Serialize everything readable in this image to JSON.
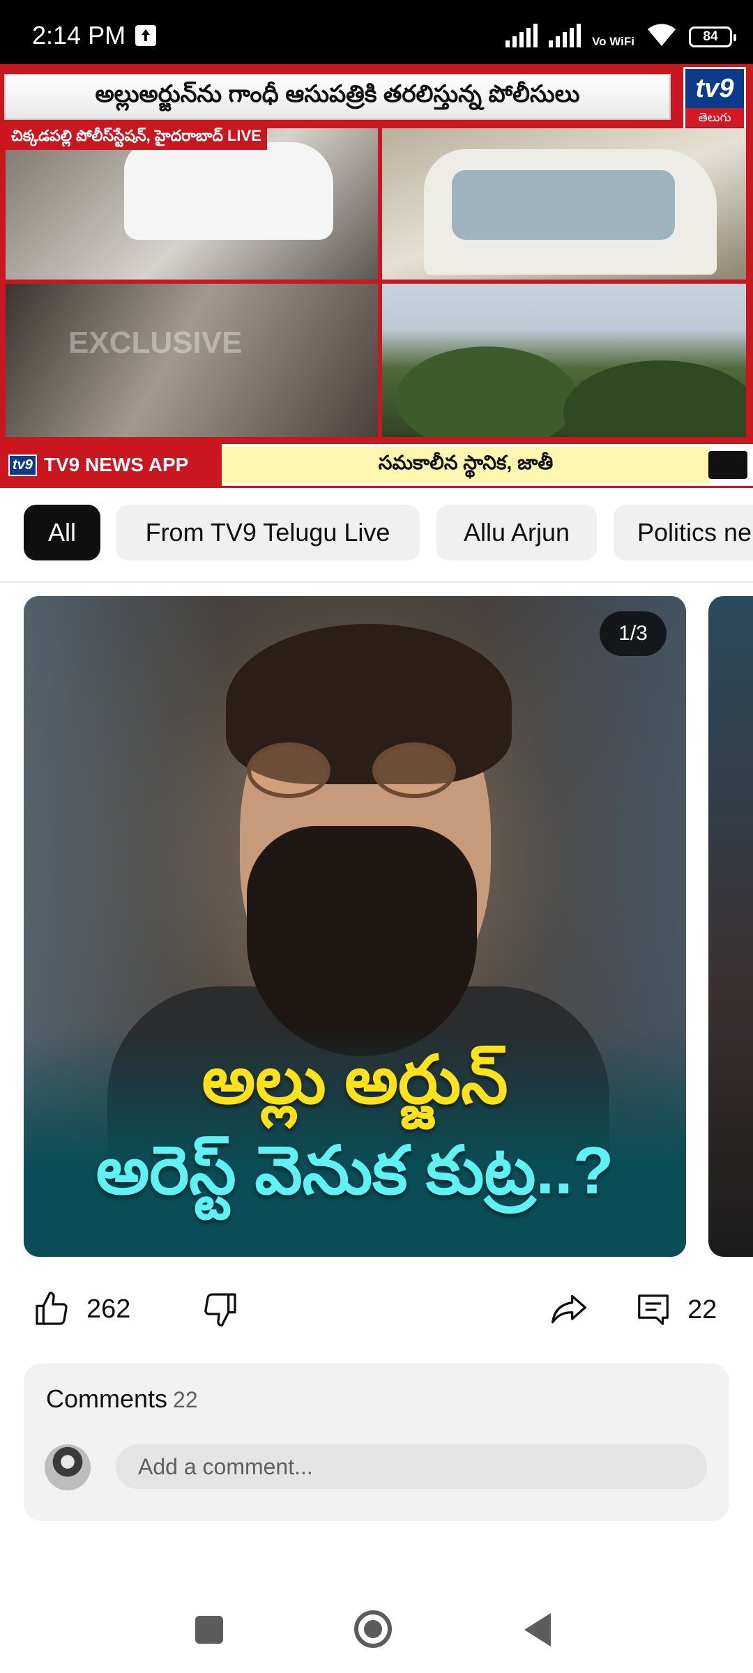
{
  "status_bar": {
    "time": "2:14 PM",
    "network_label": "Vo WiFi",
    "battery": "84"
  },
  "video": {
    "headline": "అల్లుఅర్జున్‌ను గాంధీ ఆసుపత్రికి తరలిస్తున్న పోలీసులు",
    "channel_logo": "tv9",
    "channel_logo_sub": "తెలుగు",
    "location_tag": "చిక్కడపల్లి పోలీస్‌స్టేషన్, హైదరాబాద్ LIVE",
    "watermark": "EXCLUSIVE",
    "ticker_app": "TV9 NEWS APP",
    "ticker_text": "సమకాలీన స్థానిక, జాతీ"
  },
  "chips": [
    {
      "label": "All",
      "active": true
    },
    {
      "label": "From TV9 Telugu Live"
    },
    {
      "label": "Allu Arjun"
    },
    {
      "label": "Politics ne"
    }
  ],
  "post": {
    "counter": "1/3",
    "caption_line1": "అల్లు అర్జున్",
    "caption_line2": "అరెస్ట్ వెనుక కుట్ర..?",
    "likes": "262",
    "comment_count": "22"
  },
  "comments": {
    "title": "Comments",
    "count": "22",
    "placeholder": "Add a comment..."
  },
  "colors": {
    "accent_red": "#c9161f",
    "chip_active": "#0f0f0f",
    "caption_yellow": "#ffe21a",
    "caption_cyan": "#5ff2f2"
  }
}
